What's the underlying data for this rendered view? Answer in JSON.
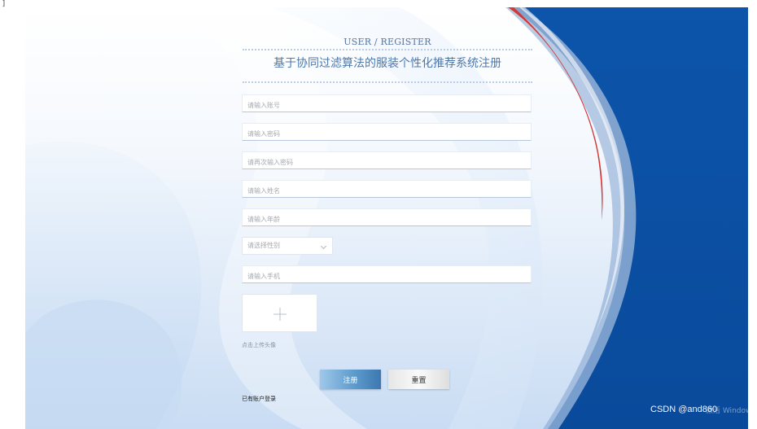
{
  "header": {
    "title_en": "USER / REGISTER",
    "title_cn": "基于协同过滤算法的服装个性化推荐系统注册"
  },
  "form": {
    "account_placeholder": "请输入账号",
    "password_placeholder": "请输入密码",
    "confirm_password_placeholder": "请再次输入密码",
    "name_placeholder": "请输入姓名",
    "age_placeholder": "请输入年龄",
    "gender_select_value": "请选择性别",
    "phone_placeholder": "请输入手机",
    "avatar_hint": "点击上传头像",
    "register_label": "注册",
    "reset_label": "重置",
    "login_link": "已有账户登录"
  },
  "watermark": "CSDN @and860",
  "activation_text": "激活 Windows 转到\"设置\"以",
  "colors": {
    "accent_dark_blue": "#0b4ea2",
    "title_blue": "#4b78ad",
    "red_stripe": "#d23a3a"
  },
  "icons": {
    "upload": "plus-icon",
    "select": "chevron-down-icon"
  }
}
